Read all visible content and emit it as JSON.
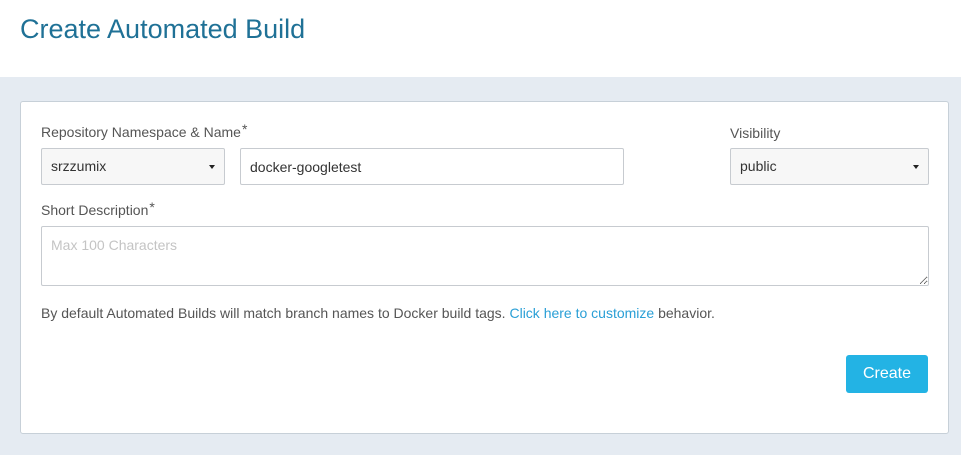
{
  "page": {
    "title": "Create Automated Build"
  },
  "form": {
    "repo_label": "Repository Namespace & Name",
    "required_mark": "*",
    "namespace_value": "srzzumix",
    "repo_name_value": "docker-googletest",
    "visibility_label": "Visibility",
    "visibility_value": "public",
    "description_label": "Short Description",
    "description_placeholder": "Max 100 Characters",
    "help_prefix": "By default Automated Builds will match branch names to Docker build tags. ",
    "help_link": "Click here to customize",
    "help_suffix": " behavior.",
    "create_label": "Create"
  },
  "icons": {
    "dropdown": "caret-down-icon"
  },
  "colors": {
    "title": "#1f7196",
    "link": "#2a9fd6",
    "primary_button": "#23b3e4",
    "page_background": "#e5ebf2"
  }
}
